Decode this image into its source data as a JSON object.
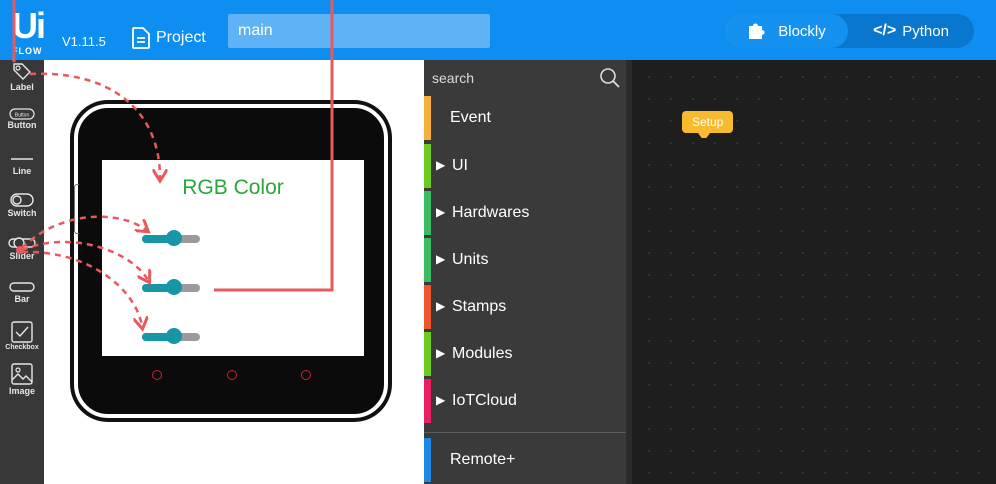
{
  "header": {
    "logo_text": "Ui",
    "logo_sub": "FLOW",
    "version": "V1.11.5",
    "project_label": "Project",
    "project_name": "main",
    "mode_blockly": "Blockly",
    "mode_python": "Python",
    "accent_color": "#0f8ef1"
  },
  "components": [
    {
      "label": "Label",
      "icon": "label-tag-icon"
    },
    {
      "label": "Button",
      "icon": "button-pill-icon"
    },
    {
      "label": "Line",
      "icon": "line-icon"
    },
    {
      "label": "Switch",
      "icon": "switch-icon"
    },
    {
      "label": "Slider",
      "icon": "slider-icon"
    },
    {
      "label": "Bar",
      "icon": "bar-icon"
    },
    {
      "label": "Checkbox",
      "icon": "checkbox-icon"
    },
    {
      "label": "Image",
      "icon": "image-icon"
    }
  ],
  "component_icon_texts": {
    "button_icon_text": "Button"
  },
  "device": {
    "screen_title": "RGB Color",
    "sliders": [
      {
        "value": 0.55
      },
      {
        "value": 0.55
      },
      {
        "value": 0.55
      }
    ]
  },
  "categories": {
    "search_placeholder": "search",
    "items": [
      {
        "label": "Event",
        "color": "#f5b03c",
        "expandable": false
      },
      {
        "label": "UI",
        "color": "#6ccb1e",
        "expandable": true
      },
      {
        "label": "Hardwares",
        "color": "#3cbc62",
        "expandable": true
      },
      {
        "label": "Units",
        "color": "#3cbc62",
        "expandable": true
      },
      {
        "label": "Stamps",
        "color": "#f0552f",
        "expandable": true
      },
      {
        "label": "Modules",
        "color": "#6ccb1e",
        "expandable": true
      },
      {
        "label": "IoTCloud",
        "color": "#e91e63",
        "expandable": true
      },
      {
        "label": "Remote+",
        "color": "#1e88e5",
        "expandable": false
      }
    ]
  },
  "workspace": {
    "setup_block": "Setup"
  }
}
